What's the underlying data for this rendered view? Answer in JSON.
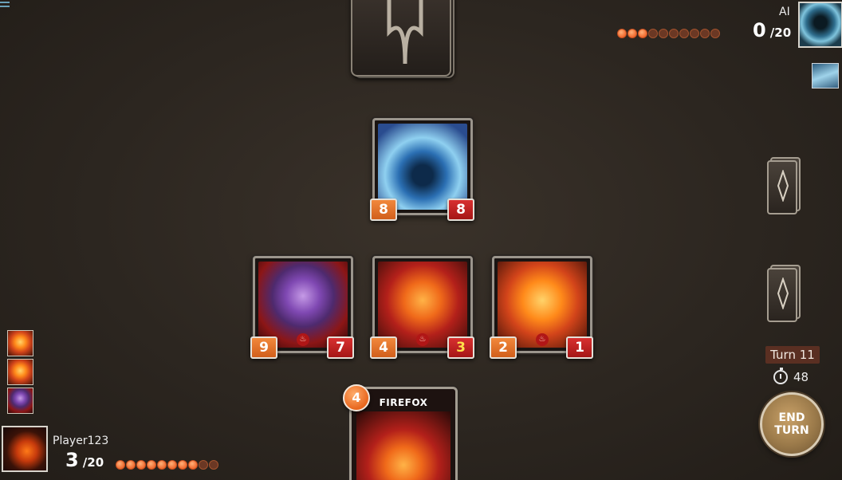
{
  "opponent": {
    "name": "AI",
    "score": "0",
    "score_max": "/20",
    "mana_filled": 3,
    "mana_total": 10
  },
  "player": {
    "name": "Player123",
    "score": "3",
    "score_max": "/20",
    "mana_filled": 8,
    "mana_total": 10
  },
  "board": {
    "opponent_cards": [
      {
        "art": "water-spirit",
        "attack": "8",
        "health": "8"
      }
    ],
    "player_cards": [
      {
        "art": "crystal-dragon",
        "attack": "9",
        "health": "7"
      },
      {
        "art": "fire-fox",
        "attack": "4",
        "health": "3"
      },
      {
        "art": "fire-cat",
        "attack": "2",
        "health": "1"
      }
    ]
  },
  "hand": {
    "name": "FIREFOX",
    "mana_cost": "4"
  },
  "turn": {
    "label": "Turn 11",
    "timer": "48"
  },
  "end_turn": {
    "label": "END TURN"
  },
  "colors": {
    "attack": "#e0702a",
    "health": "#c02020",
    "damaged_health_text": "#ffe04a",
    "mana_dot": "#f06a2e"
  }
}
